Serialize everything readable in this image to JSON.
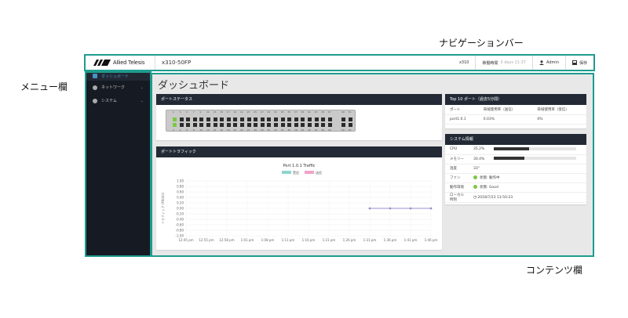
{
  "callouts": {
    "nav_bar": "ナビゲーションバー",
    "menu": "メニュー欄",
    "content": "コンテンツ欄"
  },
  "topbar": {
    "brand": "Allied Telesis",
    "model": "x310-50FP",
    "hostname": "x310",
    "uptime_label": "稼働時間",
    "uptime_value": "0 days 21:37",
    "user": "Admin",
    "save_label": "保存"
  },
  "sidebar": {
    "items": [
      {
        "label": "ダッシュボード",
        "icon": "dashboard-icon"
      },
      {
        "label": "ネットワーク",
        "icon": "network-icon"
      },
      {
        "label": "システム",
        "icon": "system-icon"
      }
    ]
  },
  "page": {
    "title": "ダッシュボード"
  },
  "port_status": {
    "title": "ポートステータス",
    "top_numbers": [
      "1",
      "3",
      "5",
      "7",
      "9",
      "11",
      "13",
      "15",
      "17",
      "19",
      "21",
      "23",
      "25",
      "27",
      "29",
      "31",
      "33",
      "35",
      "37",
      "39",
      "41",
      "43",
      "45",
      "47",
      "",
      "49",
      "51"
    ],
    "bottom_numbers": [
      "2",
      "4",
      "6",
      "8",
      "10",
      "12",
      "14",
      "16",
      "18",
      "20",
      "22",
      "24",
      "26",
      "28",
      "30",
      "32",
      "34",
      "36",
      "38",
      "40",
      "42",
      "44",
      "46",
      "48",
      "",
      "50",
      "52"
    ],
    "up_ports": [
      "1",
      "2"
    ]
  },
  "port_traffic": {
    "title": "ポートトラフィック"
  },
  "top10": {
    "title": "Top 10 ポート（過去5分間）",
    "headers": [
      "ポート",
      "帯域使用率（送信）",
      "帯域使用率（受信）"
    ],
    "rows": [
      {
        "port": "port1.0.1",
        "tx": "0.03%",
        "rx": "0%"
      }
    ]
  },
  "system_info": {
    "title": "システム情報",
    "cpu_label": "CPU",
    "cpu_value": "35.2%",
    "cpu_fraction": 0.352,
    "memory_label": "メモリー",
    "memory_value": "30.4%",
    "memory_fraction": 0.304,
    "temp_label": "温度",
    "temp_value": "33°",
    "fan_label": "ファン",
    "fan_value": "状態: 動作中",
    "status_label": "動作環境",
    "status_value": "状態: Good",
    "localtime_label": "ローカル時刻",
    "localtime_value": "2018/7/23 13:50:23"
  },
  "colors": {
    "teal_frame": "#1e9c8e",
    "sidebar_bg": "#161a22",
    "panel_head": "#232a36",
    "tx_series": "#8fd5d0",
    "rx_series": "#f0a3c8",
    "line_series": "#9c8ccc"
  },
  "chart_data": {
    "type": "line",
    "title": "Port 1.0.1 Traffic",
    "ylabel": "トラフィック (Mbit/s)",
    "ylim": [
      -1.0,
      1.0
    ],
    "yticks": [
      "1.00",
      "0.80",
      "0.60",
      "0.40",
      "0.20",
      "0.00",
      "-0.20",
      "-0.40",
      "-0.60",
      "-0.80",
      "-1.00"
    ],
    "categories": [
      "12:45 pm",
      "12:55 pm",
      "12:58 pm",
      "1:01 pm",
      "1:08 pm",
      "1:11 pm",
      "1:16 pm",
      "1:21 pm",
      "1:26 pm",
      "1:31 pm",
      "1:36 pm",
      "1:41 pm",
      "1:46 pm"
    ],
    "series": [
      {
        "name": "受信",
        "values": [
          null,
          null,
          null,
          null,
          null,
          null,
          null,
          null,
          null,
          0.0,
          0.0,
          0.0,
          0.0
        ]
      },
      {
        "name": "送信",
        "values": [
          null,
          null,
          null,
          null,
          null,
          null,
          null,
          null,
          null,
          0.0,
          0.0,
          0.0,
          0.0
        ]
      }
    ]
  }
}
